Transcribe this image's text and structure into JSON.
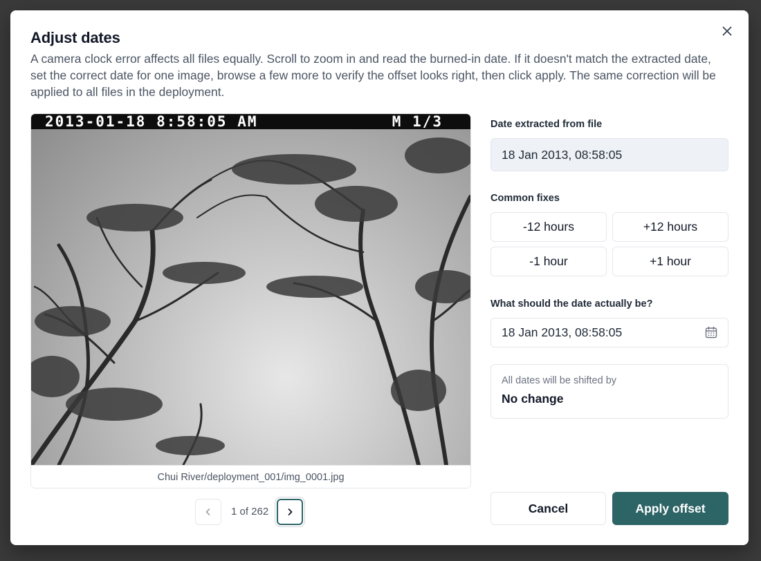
{
  "dialog": {
    "title": "Adjust dates",
    "description": "A camera clock error affects all files equally. Scroll to zoom in and read the burned-in date. If it doesn't match the extracted date, set the correct date for one image, browse a few more to verify the offset looks right, then click apply. The same correction will be applied to all files in the deployment.",
    "close_icon": "close-icon"
  },
  "image": {
    "burned_date": "2013-01-18 8:58:05 AM",
    "burned_marker": "M 1/3",
    "filename": "Chui River/deployment_001/img_0001.jpg",
    "content": "grayscale trail-camera photo of tree branches against sky"
  },
  "pager": {
    "count_text": "1 of 262",
    "prev_icon": "chevron-left-icon",
    "next_icon": "chevron-right-icon"
  },
  "extracted": {
    "label": "Date extracted from file",
    "value": "18 Jan 2013, 08:58:05"
  },
  "fixes": {
    "label": "Common fixes",
    "options": [
      "-12 hours",
      "+12 hours",
      "-1 hour",
      "+1 hour"
    ]
  },
  "target": {
    "label": "What should the date actually be?",
    "value": "18 Jan 2013, 08:58:05",
    "icon": "calendar-icon"
  },
  "shift": {
    "label": "All dates will be shifted by",
    "value": "No change"
  },
  "actions": {
    "cancel": "Cancel",
    "apply": "Apply offset"
  },
  "colors": {
    "primary": "#2d6466",
    "overlay": "#3a3a3a",
    "field_bg": "#eef1f5"
  }
}
